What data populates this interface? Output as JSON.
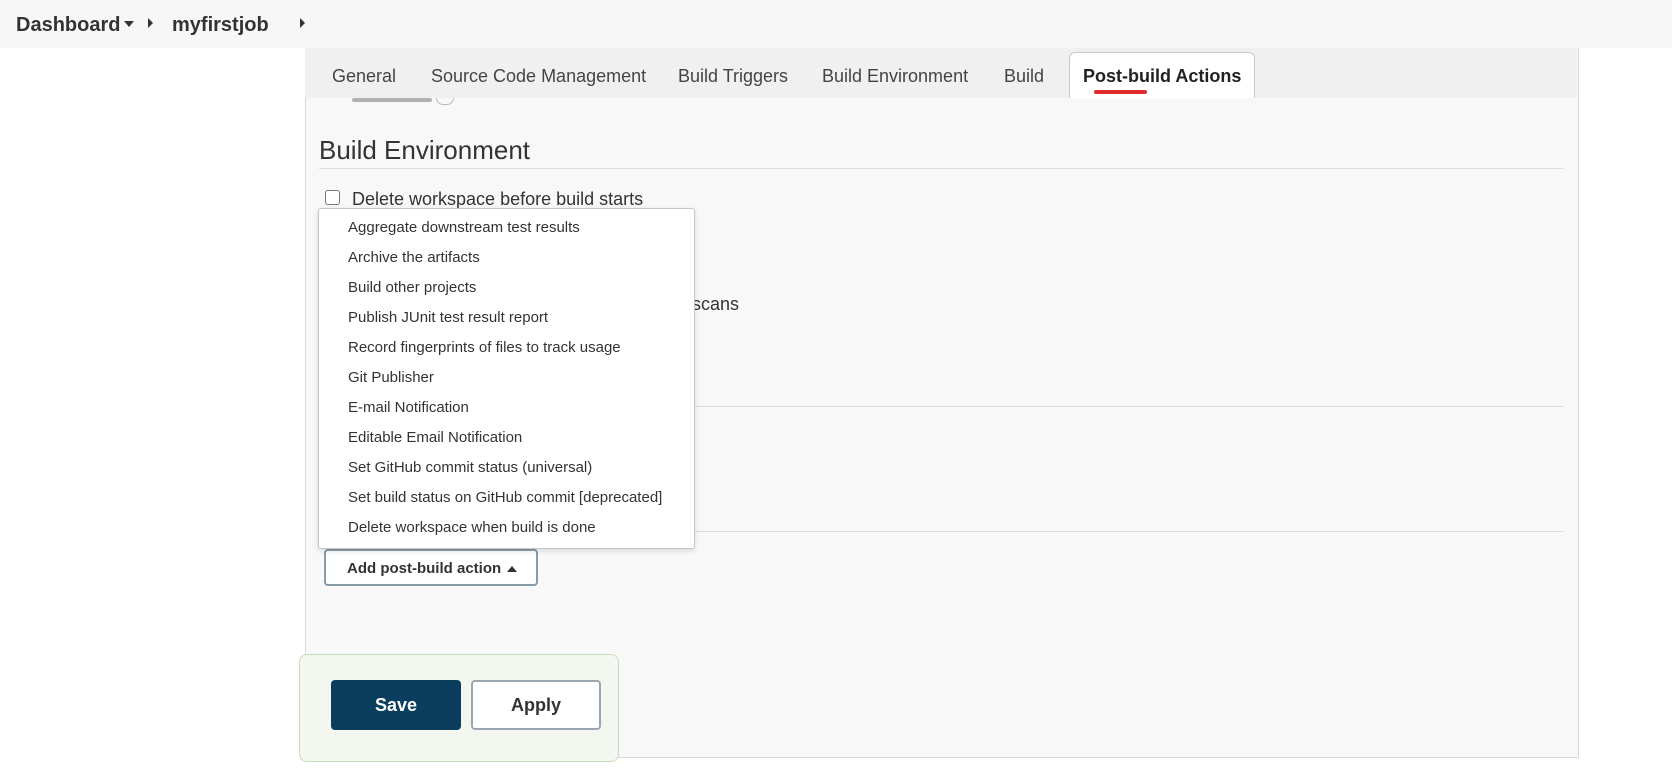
{
  "breadcrumb": {
    "dashboard": "Dashboard",
    "job": "myfirstjob"
  },
  "tabs": [
    {
      "label": "General"
    },
    {
      "label": "Source Code Management"
    },
    {
      "label": "Build Triggers"
    },
    {
      "label": "Build Environment"
    },
    {
      "label": "Build"
    },
    {
      "label": "Post-build Actions",
      "active": true
    }
  ],
  "section": {
    "title": "Build Environment",
    "checkbox_label": "Delete workspace before build starts",
    "checkbox_checked": false,
    "partial_text": "l scans"
  },
  "menu": {
    "items": [
      "Aggregate downstream test results",
      "Archive the artifacts",
      "Build other projects",
      "Publish JUnit test result report",
      "Record fingerprints of files to track usage",
      "Git Publisher",
      "E-mail Notification",
      "Editable Email Notification",
      "Set GitHub commit status (universal)",
      "Set build status on GitHub commit [deprecated]",
      "Delete workspace when build is done"
    ]
  },
  "add_action_button": "Add post-build action",
  "buttons": {
    "save": "Save",
    "apply": "Apply"
  },
  "colors": {
    "active_tab_underline": "#e12b2b",
    "save_button": "#0b3d5e",
    "save_area_background": "#f4f7ef"
  },
  "icons": [
    "chevron-down-icon",
    "chevron-right-icon",
    "caret-up-icon"
  ]
}
